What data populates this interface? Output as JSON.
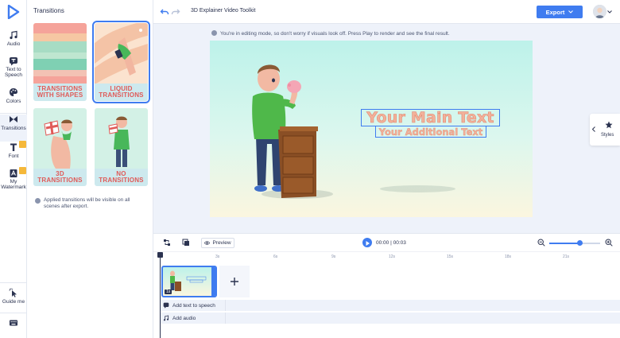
{
  "colors": {
    "accent": "#3f7cf0",
    "caption_text": "#e05a58",
    "caption_bg": "#cde9ee",
    "premium_badge": "#f5b83a"
  },
  "rail": {
    "items": [
      {
        "label": "Audio",
        "icon": "music-note-icon"
      },
      {
        "label": "Text to Speech",
        "icon": "text-to-speech-icon"
      },
      {
        "label": "Colors",
        "icon": "palette-icon"
      },
      {
        "label": "Transitions",
        "icon": "transitions-icon"
      },
      {
        "label": "Font",
        "icon": "font-icon"
      },
      {
        "label": "My Watermark",
        "icon": "watermark-icon"
      },
      {
        "label": "Guide me",
        "icon": "cursor-click-icon"
      },
      {
        "label": "",
        "icon": "keyboard-icon"
      }
    ]
  },
  "panel": {
    "title": "Transitions",
    "cards": [
      {
        "label": "TRANSITIONS WITH SHAPES",
        "selected": false
      },
      {
        "label": "LIQUID TRANSITIONS",
        "selected": true
      },
      {
        "label": "3D TRANSITIONS",
        "selected": false
      },
      {
        "label": "NO TRANSITIONS",
        "selected": false
      }
    ],
    "note": "Applied transitions will be visible on all scenes after export."
  },
  "topbar": {
    "title": "3D Explainer Video Toolkit",
    "export_label": "Export"
  },
  "editing_note": "You're in editing mode, so don't worry if visuals look off. Press Play to render and see the final result.",
  "canvas": {
    "main_text": "Your Main Text",
    "sub_text": "Your Additional Text"
  },
  "styles_tab": {
    "label": "Styles"
  },
  "timeline": {
    "preview_label": "Preview",
    "current_time": "00:00",
    "total_time": "00:03",
    "zoom_level": 0.6,
    "ticks": [
      "3s",
      "6s",
      "9s",
      "12s",
      "15s",
      "18s",
      "21s"
    ],
    "scene_number": "1s",
    "tracks": [
      {
        "label": "Add text to speech",
        "icon": "text-to-speech-icon"
      },
      {
        "label": "Add audio",
        "icon": "music-note-icon"
      }
    ]
  }
}
